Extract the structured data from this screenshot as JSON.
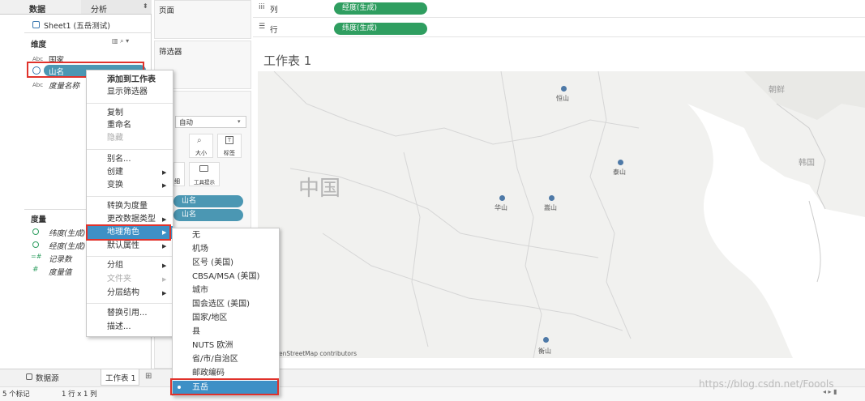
{
  "left_panel": {
    "tab_data": "数据",
    "tab_analytics": "分析",
    "source_icon": "database-icon",
    "data_source": "Sheet1 (五岳测试)",
    "dimensions_header": "维度",
    "dimensions": [
      {
        "type": "Abc",
        "name": "国家"
      },
      {
        "type": "globe",
        "name": "山名"
      },
      {
        "type": "Abc",
        "name": "度量名称"
      }
    ],
    "measures_header": "度量",
    "measures": [
      {
        "type": "globe",
        "name": "纬度(生成)"
      },
      {
        "type": "globe",
        "name": "经度(生成)"
      },
      {
        "type": "#",
        "name": "记录数"
      },
      {
        "type": "#",
        "name": "度量值"
      }
    ]
  },
  "pages_label": "页面",
  "filters_label": "筛选器",
  "marks": {
    "type": "自动",
    "size": "大小",
    "label": "标签",
    "detail": "细",
    "tooltip": "工具提示",
    "pill1": "山名",
    "pill2": "山名"
  },
  "shelves": {
    "columns_label": "列",
    "columns_pill": "经度(生成)",
    "rows_label": "行",
    "rows_pill": "纬度(生成)"
  },
  "sheet_title": "工作表 1",
  "map": {
    "countries": [
      "中国",
      "朝鲜",
      "韩国"
    ],
    "points": [
      "恒山",
      "泰山",
      "华山",
      "嵩山",
      "衡山"
    ],
    "attribution": "enStreetMap contributors"
  },
  "context_menu": {
    "items": [
      "添加到工作表",
      "显示筛选器",
      "复制",
      "重命名",
      "隐藏",
      "别名...",
      "创建",
      "变换",
      "转换为度量",
      "更改数据类型",
      "地理角色",
      "默认属性",
      "分组",
      "文件夹",
      "分层结构",
      "替换引用...",
      "描述..."
    ]
  },
  "geo_submenu": {
    "items": [
      "无",
      "机场",
      "区号 (美国)",
      "CBSA/MSA (美国)",
      "城市",
      "国会选区 (美国)",
      "国家/地区",
      "县",
      "NUTS 欧洲",
      "省/市/自治区",
      "邮政编码",
      "五岳"
    ],
    "selected": "五岳"
  },
  "bottom": {
    "datasource_tab": "数据源",
    "sheet_tab": "工作表 1",
    "marks_count": "5 个标记",
    "rows_cols": "1 行 x 1 列",
    "watermark": "https://blog.csdn.net/Foools"
  },
  "colors": {
    "pill_green": "#2f9e60",
    "pill_blue": "#4b97b3",
    "highlight_blue": "#3e90c6",
    "red": "#e0322b",
    "marker": "#4e79a7"
  }
}
